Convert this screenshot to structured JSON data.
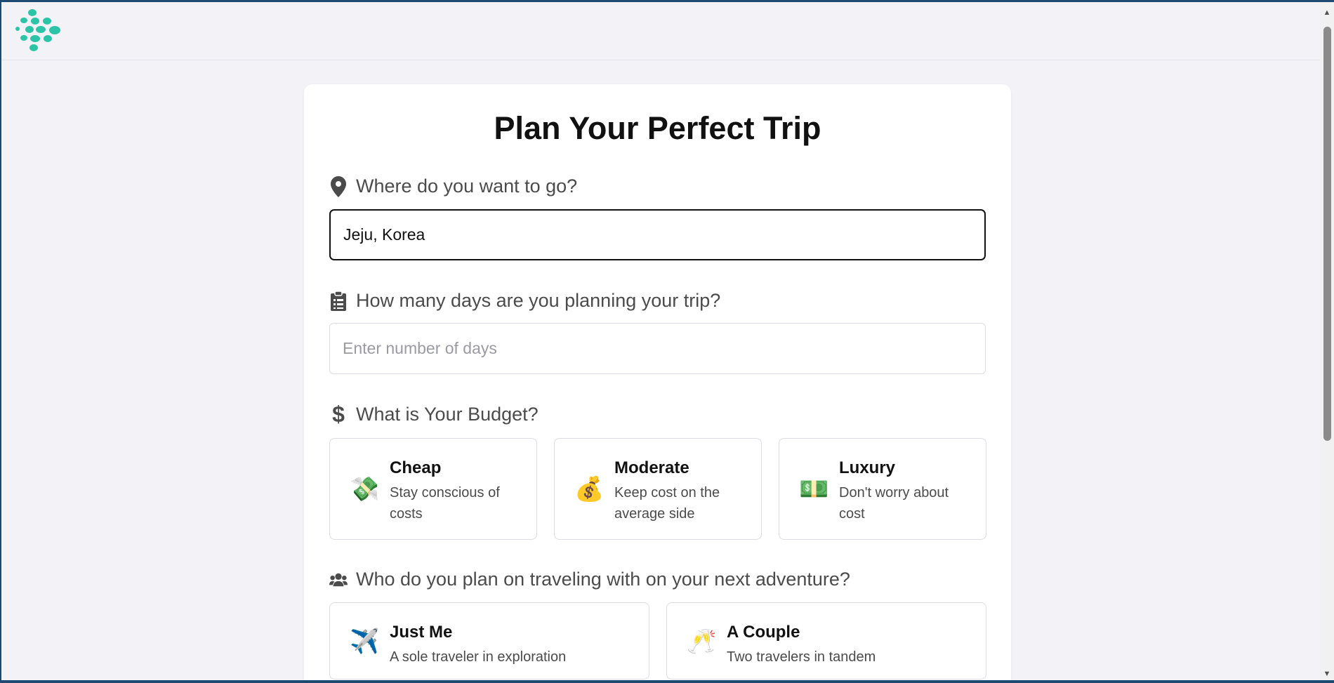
{
  "page": {
    "title": "Plan Your Perfect Trip"
  },
  "destination": {
    "label": "Where do you want to go?",
    "icon": "map-pin-icon",
    "value": "Jeju, Korea"
  },
  "days": {
    "label": "How many days are you planning your trip?",
    "icon": "clipboard-icon",
    "placeholder": "Enter number of days"
  },
  "budget": {
    "label": "What is Your Budget?",
    "icon": "dollar-icon",
    "options": [
      {
        "title": "Cheap",
        "desc": "Stay conscious of costs",
        "icon": "flying-money-icon",
        "emoji": "💸"
      },
      {
        "title": "Moderate",
        "desc": "Keep cost on the average side",
        "icon": "money-bag-icon",
        "emoji": "💰"
      },
      {
        "title": "Luxury",
        "desc": "Don't worry about cost",
        "icon": "dollar-banknote-icon",
        "emoji": "💵"
      }
    ]
  },
  "travelers": {
    "label": "Who do you plan on traveling with on your next adventure?",
    "icon": "users-icon",
    "options": [
      {
        "title": "Just Me",
        "desc": "A sole traveler in exploration",
        "icon": "airplane-icon",
        "emoji": "✈️"
      },
      {
        "title": "A Couple",
        "desc": "Two travelers in tandem",
        "icon": "clinking-glasses-icon",
        "emoji": "🥂"
      }
    ]
  },
  "colors": {
    "logo": "#2bc4a6",
    "background": "#f3f3f7",
    "card": "#ffffff"
  }
}
